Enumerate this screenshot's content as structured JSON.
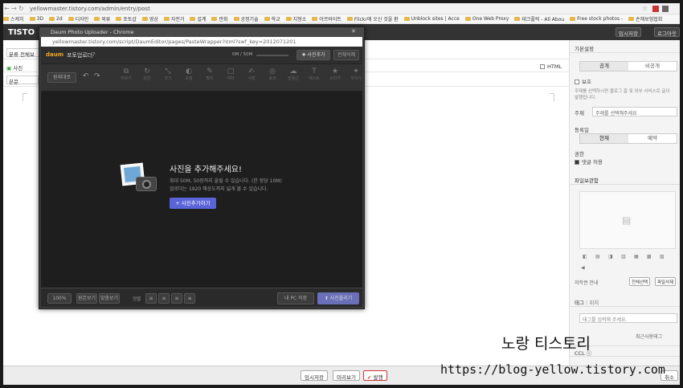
{
  "browser": {
    "url": "yellowmaster.tistory.com/admin/entry/post",
    "bookmarks": [
      "스케치",
      "3D",
      "2d",
      "디자인",
      "외류",
      "포토샵",
      "영상",
      "자전거",
      "설계",
      "만화",
      "공정기술",
      "학교",
      "치형소",
      "아르바이트",
      "Flickr에 오신 것을 환",
      "Unblock sites | Acce",
      "One Web Proxy",
      "테크플릭 - All Abou",
      "Free stock photos -",
      "손해보험협회"
    ]
  },
  "app": {
    "logo": "TISTO",
    "draft_save": "임시저장",
    "logout": "로그아웃"
  },
  "editor": {
    "category": "분류 전체보",
    "photo_btn": "사진",
    "format": "본문",
    "html_label": "HTML"
  },
  "popup": {
    "window_title": "Daum Photo Uploader - Chrome",
    "address": "yellowmaster.tistory.com/script/DaumEditor/pages/PasteWrapper.html?swf_key=2012071201",
    "brand": "daum",
    "title": "포토업로더",
    "help": "?",
    "size_indicator": "0M / 50M",
    "add_photo": "사진추가",
    "delete_all": "전체삭제",
    "restore": "원래대로",
    "tools": [
      "자르기",
      "회전",
      "크기",
      "보정",
      "필터",
      "액자",
      "서명",
      "효과",
      "말풍선",
      "텍스트",
      "스티커",
      "꾸미기"
    ],
    "headline": "사진을 추가해주세요!",
    "desc1": "최대 50M, 50장까지 올릴 수 있습니다. (한 장당 10M)",
    "desc2": "업로더는 1920 해상도까지 넓게 볼 수 있습니다.",
    "add_photo_big": "+ 사진추가하기",
    "zoom": "100%",
    "view_original": "원본보기",
    "fit_view": "맞춤보기",
    "align_label": "정렬",
    "to_pc": "내 PC 저장",
    "upload": "사진올리기"
  },
  "sidebar": {
    "basic_settings": "기본설정",
    "public": "공개",
    "private": "비공개",
    "protect": "보호",
    "protect_desc": "주제를 선택하시면 블로그 홈 및 외부 서비스로 글이 발행됩니다.",
    "topic_label": "주제",
    "topic_placeholder": "주제를 선택해주세요",
    "publish_date": "등록일",
    "now": "현재",
    "reserve": "예약",
    "permission": "권한",
    "allow_comments": "댓글 허용",
    "file_storage": "파일보관함",
    "copyright": "저작권 안내",
    "select_all": "전체선택",
    "delete_file": "파일삭제",
    "tag_tab": "태그",
    "location_tab": "위치",
    "tag_placeholder": "태그를 입력해 주세요.",
    "recent_tags": "최근사용태그",
    "ccl": "CCL"
  },
  "bottom": {
    "draft": "임시저장",
    "preview": "미리보기",
    "publish": "발행",
    "cancel": "취소"
  },
  "watermark": {
    "line1": "노랑 티스토리",
    "line2": "https://blog-yellow.tistory.com"
  }
}
